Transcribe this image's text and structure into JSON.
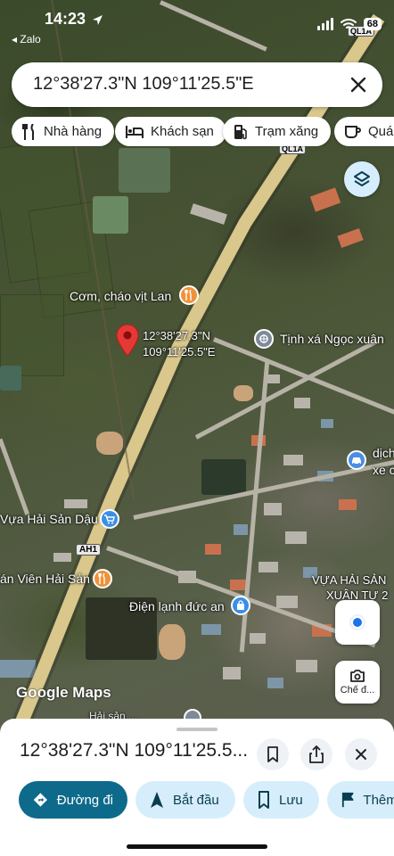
{
  "status_bar": {
    "time": "14:23",
    "back_app": "◂ Zalo",
    "battery": "68"
  },
  "search": {
    "query": "12°38'27.3\"N 109°11'25.5\"E"
  },
  "chips": [
    {
      "label": "Nhà hàng",
      "icon": "restaurant-icon"
    },
    {
      "label": "Khách sạn",
      "icon": "hotel-icon"
    },
    {
      "label": "Trạm xăng",
      "icon": "gas-station-icon"
    },
    {
      "label": "Quán",
      "icon": "cafe-icon"
    }
  ],
  "map": {
    "pin_label_line1": "12°38'27.3\"N",
    "pin_label_line2": "109°11'25.5\"E",
    "route_shields": [
      "QL1A",
      "QL1A",
      "AH1"
    ],
    "places": [
      {
        "label": "Cơm, cháo vịt Lan",
        "icon": "restaurant-icon",
        "color": "#f0923a"
      },
      {
        "label": "Tịnh xá Ngọc xuân",
        "icon": "temple-icon",
        "color": "#7d8a99"
      },
      {
        "label": "Vựa Hải Sản Dậu",
        "icon": "shopping-icon",
        "color": "#3b8fe6"
      },
      {
        "label": "án Viên Hải Sản",
        "icon": "restaurant-icon",
        "color": "#f0923a"
      },
      {
        "label": "Điện lạnh đức an",
        "icon": "shopping-bag-icon",
        "color": "#3b8fe6"
      },
      {
        "label": "VỰA HẢI SẢN",
        "icon": "",
        "color": ""
      },
      {
        "label": "XUÂN TỰ 2",
        "icon": "",
        "color": ""
      },
      {
        "label": "dịch",
        "icon": "",
        "color": ""
      },
      {
        "label": "xe c",
        "icon": "car-service-icon",
        "color": "#4a8fe0"
      },
      {
        "label": "Hải sản ...",
        "icon": "",
        "color": ""
      }
    ],
    "attribution": "Google Maps",
    "street_view_label": "Chế đ..."
  },
  "sheet": {
    "title": "12°38'27.3\"N 109°11'25.5...",
    "actions": [
      {
        "label": "Đường đi",
        "icon": "directions-icon"
      },
      {
        "label": "Bắt đầu",
        "icon": "navigation-arrow-icon"
      },
      {
        "label": "Lưu",
        "icon": "bookmark-icon"
      },
      {
        "label": "Thêm",
        "icon": "flag-icon"
      }
    ]
  },
  "colors": {
    "primary_action": "#0e6a8a",
    "action_bg": "#d6eefc",
    "pin": "#e53935",
    "highway": "#d9c78b"
  }
}
